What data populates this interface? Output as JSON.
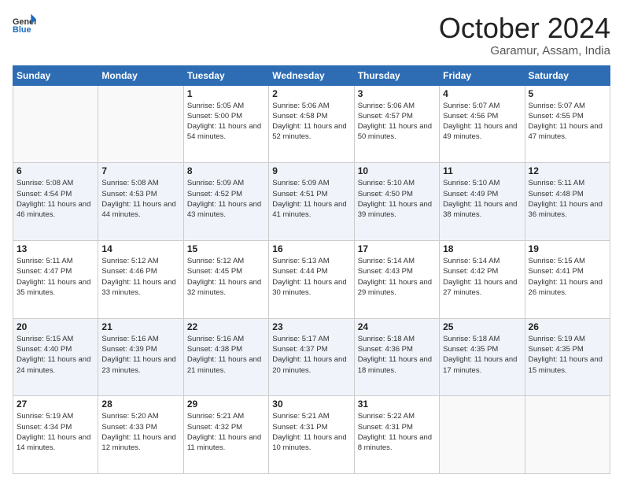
{
  "header": {
    "logo_general": "General",
    "logo_blue": "Blue",
    "month": "October 2024",
    "location": "Garamur, Assam, India"
  },
  "weekdays": [
    "Sunday",
    "Monday",
    "Tuesday",
    "Wednesday",
    "Thursday",
    "Friday",
    "Saturday"
  ],
  "rows": [
    [
      {
        "day": "",
        "empty": true
      },
      {
        "day": "",
        "empty": true
      },
      {
        "day": "1",
        "sunrise": "5:05 AM",
        "sunset": "5:00 PM",
        "daylight": "11 hours and 54 minutes."
      },
      {
        "day": "2",
        "sunrise": "5:06 AM",
        "sunset": "4:58 PM",
        "daylight": "11 hours and 52 minutes."
      },
      {
        "day": "3",
        "sunrise": "5:06 AM",
        "sunset": "4:57 PM",
        "daylight": "11 hours and 50 minutes."
      },
      {
        "day": "4",
        "sunrise": "5:07 AM",
        "sunset": "4:56 PM",
        "daylight": "11 hours and 49 minutes."
      },
      {
        "day": "5",
        "sunrise": "5:07 AM",
        "sunset": "4:55 PM",
        "daylight": "11 hours and 47 minutes."
      }
    ],
    [
      {
        "day": "6",
        "sunrise": "5:08 AM",
        "sunset": "4:54 PM",
        "daylight": "11 hours and 46 minutes."
      },
      {
        "day": "7",
        "sunrise": "5:08 AM",
        "sunset": "4:53 PM",
        "daylight": "11 hours and 44 minutes."
      },
      {
        "day": "8",
        "sunrise": "5:09 AM",
        "sunset": "4:52 PM",
        "daylight": "11 hours and 43 minutes."
      },
      {
        "day": "9",
        "sunrise": "5:09 AM",
        "sunset": "4:51 PM",
        "daylight": "11 hours and 41 minutes."
      },
      {
        "day": "10",
        "sunrise": "5:10 AM",
        "sunset": "4:50 PM",
        "daylight": "11 hours and 39 minutes."
      },
      {
        "day": "11",
        "sunrise": "5:10 AM",
        "sunset": "4:49 PM",
        "daylight": "11 hours and 38 minutes."
      },
      {
        "day": "12",
        "sunrise": "5:11 AM",
        "sunset": "4:48 PM",
        "daylight": "11 hours and 36 minutes."
      }
    ],
    [
      {
        "day": "13",
        "sunrise": "5:11 AM",
        "sunset": "4:47 PM",
        "daylight": "11 hours and 35 minutes."
      },
      {
        "day": "14",
        "sunrise": "5:12 AM",
        "sunset": "4:46 PM",
        "daylight": "11 hours and 33 minutes."
      },
      {
        "day": "15",
        "sunrise": "5:12 AM",
        "sunset": "4:45 PM",
        "daylight": "11 hours and 32 minutes."
      },
      {
        "day": "16",
        "sunrise": "5:13 AM",
        "sunset": "4:44 PM",
        "daylight": "11 hours and 30 minutes."
      },
      {
        "day": "17",
        "sunrise": "5:14 AM",
        "sunset": "4:43 PM",
        "daylight": "11 hours and 29 minutes."
      },
      {
        "day": "18",
        "sunrise": "5:14 AM",
        "sunset": "4:42 PM",
        "daylight": "11 hours and 27 minutes."
      },
      {
        "day": "19",
        "sunrise": "5:15 AM",
        "sunset": "4:41 PM",
        "daylight": "11 hours and 26 minutes."
      }
    ],
    [
      {
        "day": "20",
        "sunrise": "5:15 AM",
        "sunset": "4:40 PM",
        "daylight": "11 hours and 24 minutes."
      },
      {
        "day": "21",
        "sunrise": "5:16 AM",
        "sunset": "4:39 PM",
        "daylight": "11 hours and 23 minutes."
      },
      {
        "day": "22",
        "sunrise": "5:16 AM",
        "sunset": "4:38 PM",
        "daylight": "11 hours and 21 minutes."
      },
      {
        "day": "23",
        "sunrise": "5:17 AM",
        "sunset": "4:37 PM",
        "daylight": "11 hours and 20 minutes."
      },
      {
        "day": "24",
        "sunrise": "5:18 AM",
        "sunset": "4:36 PM",
        "daylight": "11 hours and 18 minutes."
      },
      {
        "day": "25",
        "sunrise": "5:18 AM",
        "sunset": "4:35 PM",
        "daylight": "11 hours and 17 minutes."
      },
      {
        "day": "26",
        "sunrise": "5:19 AM",
        "sunset": "4:35 PM",
        "daylight": "11 hours and 15 minutes."
      }
    ],
    [
      {
        "day": "27",
        "sunrise": "5:19 AM",
        "sunset": "4:34 PM",
        "daylight": "11 hours and 14 minutes."
      },
      {
        "day": "28",
        "sunrise": "5:20 AM",
        "sunset": "4:33 PM",
        "daylight": "11 hours and 12 minutes."
      },
      {
        "day": "29",
        "sunrise": "5:21 AM",
        "sunset": "4:32 PM",
        "daylight": "11 hours and 11 minutes."
      },
      {
        "day": "30",
        "sunrise": "5:21 AM",
        "sunset": "4:31 PM",
        "daylight": "11 hours and 10 minutes."
      },
      {
        "day": "31",
        "sunrise": "5:22 AM",
        "sunset": "4:31 PM",
        "daylight": "11 hours and 8 minutes."
      },
      {
        "day": "",
        "empty": true
      },
      {
        "day": "",
        "empty": true
      }
    ]
  ]
}
